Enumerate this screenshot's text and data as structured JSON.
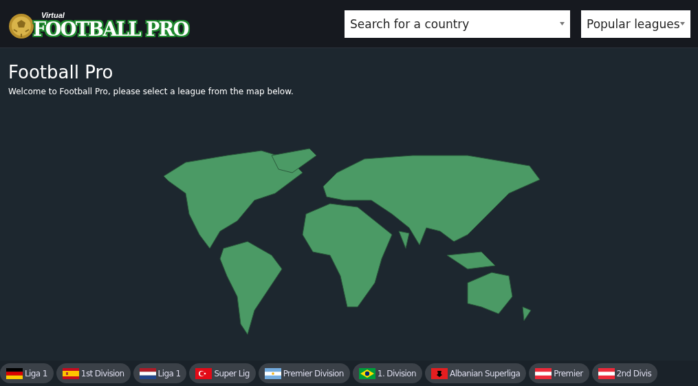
{
  "logo": {
    "tagline": "Virtual",
    "name": "FOOTBALL PRO"
  },
  "dropdowns": [
    {
      "value": "Search for a country"
    },
    {
      "value": "Popular leagues"
    }
  ],
  "page": {
    "title": "Football Pro",
    "intro": "Welcome to Football Pro, please select a league from the map below."
  },
  "map": {
    "kind": "world"
  },
  "leagues": [
    {
      "label": "Liga 1",
      "kind": "germany"
    },
    {
      "label": "1st Division",
      "kind": "spain"
    },
    {
      "label": "Liga 1",
      "kind": "netherlands"
    },
    {
      "label": "Super Lig",
      "kind": "turkey"
    },
    {
      "label": "Premier Division",
      "kind": "argentina"
    },
    {
      "label": "1. Division",
      "kind": "brazil"
    },
    {
      "label": "Albanian Superliga",
      "kind": "albania"
    },
    {
      "label": "Premier",
      "kind": "austria"
    },
    {
      "label": "2nd Divis",
      "kind": "austria"
    }
  ]
}
